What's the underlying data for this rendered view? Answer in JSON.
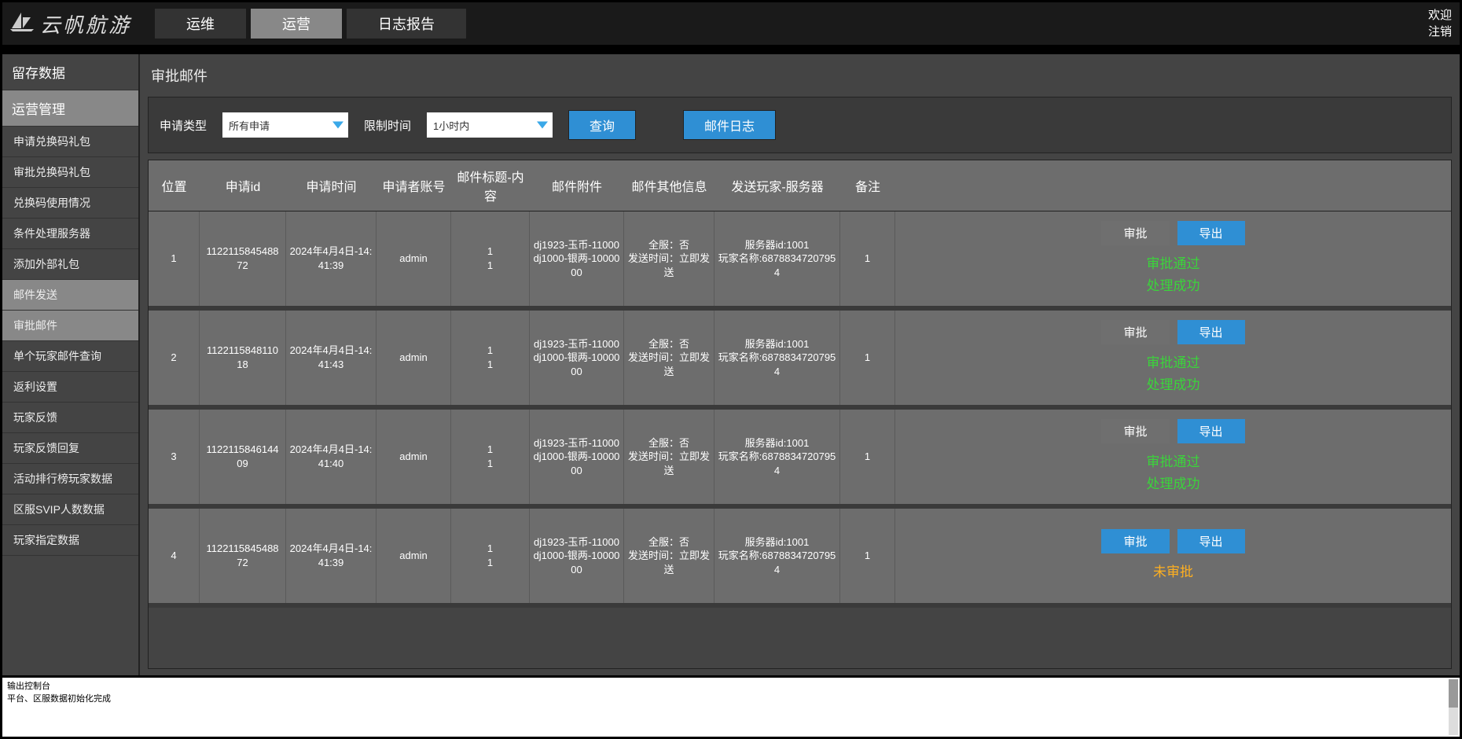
{
  "header": {
    "logo_text": "云帆航游",
    "nav": [
      "运维",
      "运营",
      "日志报告"
    ],
    "active_nav": 1,
    "right": {
      "welcome": "欢迎",
      "logout": "注销"
    }
  },
  "sidebar": {
    "sections": [
      {
        "label": "留存数据",
        "active": false
      },
      {
        "label": "运营管理",
        "active": true
      }
    ],
    "items": [
      {
        "label": "申请兑换码礼包",
        "active": false
      },
      {
        "label": "审批兑换码礼包",
        "active": false
      },
      {
        "label": "兑换码使用情况",
        "active": false
      },
      {
        "label": "条件处理服务器",
        "active": false
      },
      {
        "label": "添加外部礼包",
        "active": false
      },
      {
        "label": "邮件发送",
        "active": true
      },
      {
        "label": "审批邮件",
        "active": true
      },
      {
        "label": "单个玩家邮件查询",
        "active": false
      },
      {
        "label": "返利设置",
        "active": false
      },
      {
        "label": "玩家反馈",
        "active": false
      },
      {
        "label": "玩家反馈回复",
        "active": false
      },
      {
        "label": "活动排行榜玩家数据",
        "active": false
      },
      {
        "label": "区服SVIP人数数据",
        "active": false
      },
      {
        "label": "玩家指定数据",
        "active": false
      }
    ]
  },
  "main": {
    "title": "审批邮件",
    "filters": {
      "type_label": "申请类型",
      "type_value": "所有申请",
      "limit_label": "限制时间",
      "limit_value": "1小时内",
      "query_btn": "查询",
      "log_btn": "邮件日志"
    },
    "columns": [
      "位置",
      "申请id",
      "申请时间",
      "申请者账号",
      "邮件标题-内容",
      "邮件附件",
      "邮件其他信息",
      "发送玩家-服务器",
      "备注"
    ],
    "action_labels": {
      "approve": "审批",
      "export": "导出"
    },
    "status_labels": {
      "approved": "审批通过",
      "processed": "处理成功",
      "pending": "未审批"
    },
    "rows": [
      {
        "pos": "1",
        "id": "1122115845488\n72",
        "time": "2024年4月4日-14:41:39",
        "acct": "admin",
        "title_line1": "1",
        "title_line2": "1",
        "attach": "dj1923-玉币-11000\ndj1000-银两-1000000",
        "other": "全服：否\n发送时间：立即发送",
        "player": "服务器id:1001\n玩家名称:68788347207954",
        "remark": "1",
        "approve_style": "gray",
        "status": [
          "approved",
          "processed"
        ]
      },
      {
        "pos": "2",
        "id": "1122115848110\n18",
        "time": "2024年4月4日-14:41:43",
        "acct": "admin",
        "title_line1": "1",
        "title_line2": "1",
        "attach": "dj1923-玉币-11000\ndj1000-银两-1000000",
        "other": "全服：否\n发送时间：立即发送",
        "player": "服务器id:1001\n玩家名称:68788347207954",
        "remark": "1",
        "approve_style": "gray",
        "status": [
          "approved",
          "processed"
        ]
      },
      {
        "pos": "3",
        "id": "1122115846144\n09",
        "time": "2024年4月4日-14:41:40",
        "acct": "admin",
        "title_line1": "1",
        "title_line2": "1",
        "attach": "dj1923-玉币-11000\ndj1000-银两-1000000",
        "other": "全服：否\n发送时间：立即发送",
        "player": "服务器id:1001\n玩家名称:68788347207954",
        "remark": "1",
        "approve_style": "gray",
        "status": [
          "approved",
          "processed"
        ]
      },
      {
        "pos": "4",
        "id": "1122115845488\n72",
        "time": "2024年4月4日-14:41:39",
        "acct": "admin",
        "title_line1": "1",
        "title_line2": "1",
        "attach": "dj1923-玉币-11000\ndj1000-银两-1000000",
        "other": "全服：否\n发送时间：立即发送",
        "player": "服务器id:1001\n玩家名称:68788347207954",
        "remark": "1",
        "approve_style": "blue",
        "status": [
          "pending"
        ]
      }
    ]
  },
  "console": {
    "line1": "输出控制台",
    "line2": "平台、区服数据初始化完成"
  }
}
